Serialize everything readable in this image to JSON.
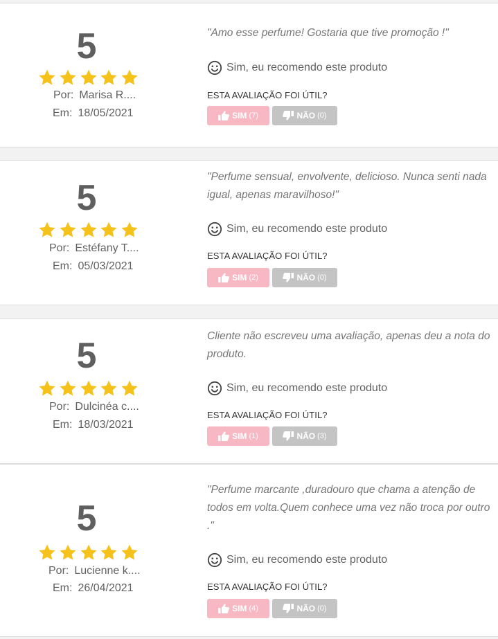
{
  "colors": {
    "star": "#f5c21b",
    "yes_button": "#f7b8c4",
    "no_button": "#c4c4c4"
  },
  "icons": {
    "recommend": "smiley-icon",
    "yes": "thumbs-up-icon",
    "no": "thumbs-down-icon"
  },
  "reviews": [
    {
      "rating": "5",
      "stars": 5,
      "by_label": "Por:",
      "author": "Marisa R....",
      "on_label": "Em:",
      "date": "18/05/2021",
      "quote": "\"Amo esse perfume! Gostaria que tive promoção !\"",
      "recommend": "Sim, eu recomendo este produto",
      "helpful_question": "ESTA AVALIAÇÃO FOI ÚTIL?",
      "yes_label": "SIM",
      "yes_count": "(7)",
      "no_label": "NÃO",
      "no_count": "(0)"
    },
    {
      "rating": "5",
      "stars": 5,
      "by_label": "Por:",
      "author": "Estéfany T....",
      "on_label": "Em:",
      "date": "05/03/2021",
      "quote": "\"Perfume sensual, envolvente, delicioso. Nunca senti nada igual, apenas maravilhoso!\"",
      "recommend": "Sim, eu recomendo este produto",
      "helpful_question": "ESTA AVALIAÇÃO FOI ÚTIL?",
      "yes_label": "SIM",
      "yes_count": "(2)",
      "no_label": "NÃO",
      "no_count": "(0)"
    },
    {
      "rating": "5",
      "stars": 5,
      "by_label": "Por:",
      "author": "Dulcinéa c....",
      "on_label": "Em:",
      "date": "18/03/2021",
      "quote": "Cliente não escreveu uma avaliação, apenas deu a nota do produto.",
      "recommend": "Sim, eu recomendo este produto",
      "helpful_question": "ESTA AVALIAÇÃO FOI ÚTIL?",
      "yes_label": "SIM",
      "yes_count": "(1)",
      "no_label": "NÃO",
      "no_count": "(3)"
    },
    {
      "rating": "5",
      "stars": 5,
      "by_label": "Por:",
      "author": "Lucienne k....",
      "on_label": "Em:",
      "date": "26/04/2021",
      "quote": "\"Perfume marcante ,duradouro que chama a atenção de todos em volta.Quem conhece uma vez não troca por outro .\"",
      "recommend": "Sim, eu recomendo este produto",
      "helpful_question": "ESTA AVALIAÇÃO FOI ÚTIL?",
      "yes_label": "SIM",
      "yes_count": "(4)",
      "no_label": "NÃO",
      "no_count": "(0)"
    }
  ]
}
